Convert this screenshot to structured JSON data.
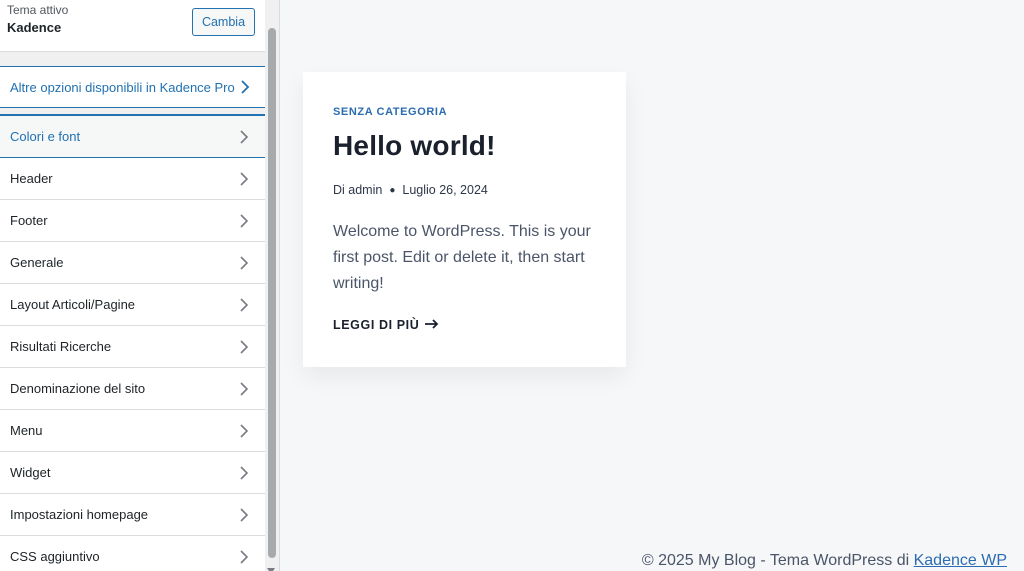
{
  "sidebar": {
    "theme_label": "Tema attivo",
    "theme_name": "Kadence",
    "change_button": "Cambia",
    "pro_options": "Altre opzioni disponibili in Kadence Pro",
    "items": [
      {
        "label": "Colori e font",
        "active": true
      },
      {
        "label": "Header"
      },
      {
        "label": "Footer"
      },
      {
        "label": "Generale"
      },
      {
        "label": "Layout Articoli/Pagine"
      },
      {
        "label": "Risultati Ricerche"
      },
      {
        "label": "Denominazione del sito"
      },
      {
        "label": "Menu"
      },
      {
        "label": "Widget"
      },
      {
        "label": "Impostazioni homepage"
      },
      {
        "label": "CSS aggiuntivo"
      }
    ]
  },
  "post": {
    "category": "SENZA CATEGORIA",
    "title": "Hello world!",
    "author": "Di admin",
    "date": "Luglio 26, 2024",
    "excerpt": "Welcome to WordPress. This is your first post. Edit or delete it, then start writing!",
    "read_more": "LEGGI DI PIÙ"
  },
  "footer": {
    "credit_text": "© 2025 My Blog - Tema WordPress di ",
    "credit_link": "Kadence WP"
  },
  "colors": {
    "accent": "#2271b1",
    "link": "#2b6cb0",
    "preview_bg": "#f6f7f9"
  }
}
